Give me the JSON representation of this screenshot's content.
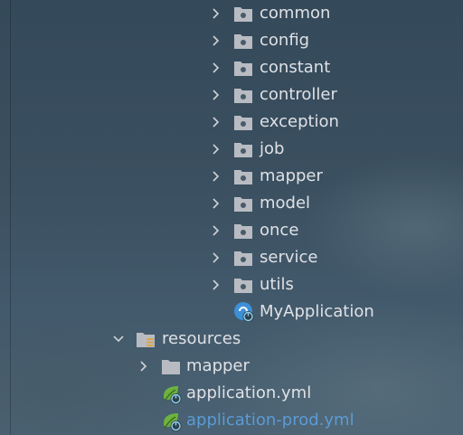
{
  "project_tree": {
    "packages": [
      {
        "label": "common",
        "icon": "package-folder-icon"
      },
      {
        "label": "config",
        "icon": "package-folder-icon"
      },
      {
        "label": "constant",
        "icon": "package-folder-icon"
      },
      {
        "label": "controller",
        "icon": "package-folder-icon"
      },
      {
        "label": "exception",
        "icon": "package-folder-icon"
      },
      {
        "label": "job",
        "icon": "package-folder-icon"
      },
      {
        "label": "mapper",
        "icon": "package-folder-icon"
      },
      {
        "label": "model",
        "icon": "package-folder-icon"
      },
      {
        "label": "once",
        "icon": "package-folder-icon"
      },
      {
        "label": "service",
        "icon": "package-folder-icon"
      },
      {
        "label": "utils",
        "icon": "package-folder-icon"
      }
    ],
    "main_class": {
      "label": "MyApplication",
      "icon": "spring-boot-class-icon"
    },
    "resources": {
      "label": "resources",
      "icon": "resources-folder-icon",
      "expanded": true,
      "children": [
        {
          "label": "mapper",
          "icon": "folder-icon"
        },
        {
          "label": "application.yml",
          "icon": "spring-yaml-icon"
        },
        {
          "label": "application-prod.yml",
          "icon": "spring-yaml-icon",
          "text_color": "#5b9bd5"
        }
      ]
    }
  },
  "colors": {
    "text": "#dfe1e5",
    "modified_text": "#5b9bd5",
    "folder_icon": "#b8bcc2",
    "spring_green": "#6cb33e",
    "class_blue": "#3d8fd6"
  }
}
